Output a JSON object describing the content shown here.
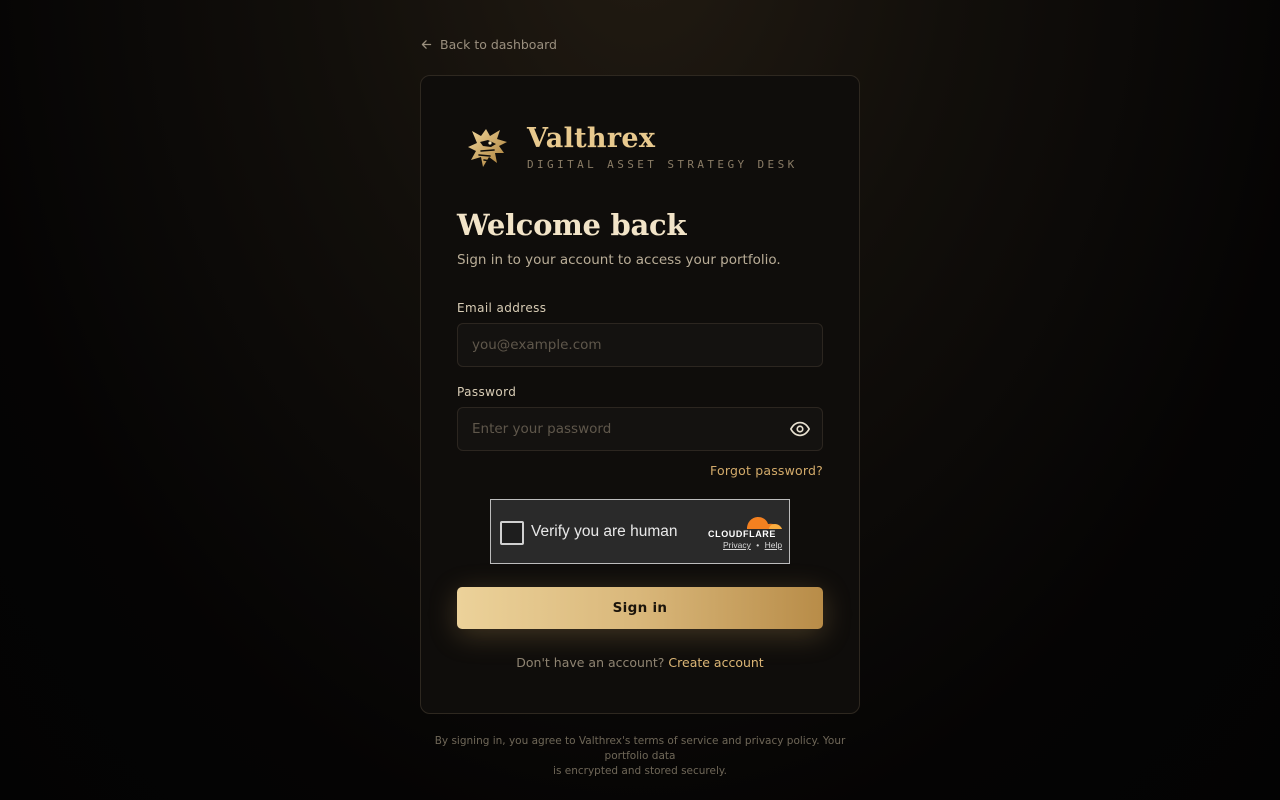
{
  "back_link": {
    "label": "Back to dashboard",
    "icon": "arrow-left-icon"
  },
  "brand": {
    "name": "Valthrex",
    "tagline": "DIGITAL ASSET STRATEGY DESK",
    "logo_icon": "dragon-head-icon",
    "accent_color": "#e8c98e"
  },
  "form": {
    "heading": "Welcome back",
    "subheading": "Sign in to your account to access your portfolio.",
    "email": {
      "label": "Email address",
      "placeholder": "you@example.com",
      "value": ""
    },
    "password": {
      "label": "Password",
      "placeholder": "Enter your password",
      "value": "",
      "toggle_icon": "eye-icon"
    },
    "forgot_label": "Forgot password?",
    "captcha": {
      "label": "Verify you are human",
      "provider": "CLOUDFLARE",
      "privacy_label": "Privacy",
      "separator": "•",
      "help_label": "Help"
    },
    "submit_label": "Sign in",
    "signup_prompt": "Don't have an account?",
    "signup_link": "Create account"
  },
  "legal": {
    "line1": "By signing in, you agree to Valthrex's terms of service and privacy policy. Your portfolio data",
    "line2": "is encrypted and stored securely."
  }
}
